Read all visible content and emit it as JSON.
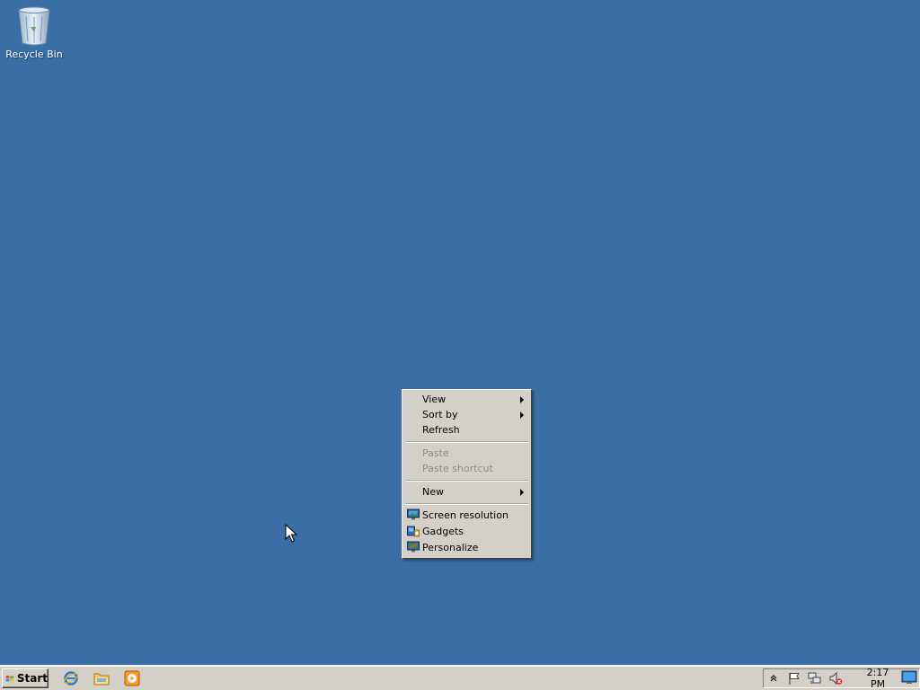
{
  "desktop": {
    "icons": [
      {
        "label": "Recycle Bin",
        "icon": "recycle-bin-icon"
      }
    ]
  },
  "context_menu": {
    "items": [
      {
        "label": "View",
        "submenu": true,
        "enabled": true
      },
      {
        "label": "Sort by",
        "submenu": true,
        "enabled": true
      },
      {
        "label": "Refresh",
        "submenu": false,
        "enabled": true
      },
      {
        "label": "Paste",
        "submenu": false,
        "enabled": false
      },
      {
        "label": "Paste shortcut",
        "submenu": false,
        "enabled": false
      },
      {
        "label": "New",
        "submenu": true,
        "enabled": true
      },
      {
        "label": "Screen resolution",
        "icon": "screen-resolution-icon",
        "enabled": true
      },
      {
        "label": "Gadgets",
        "icon": "gadgets-icon",
        "enabled": true
      },
      {
        "label": "Personalize",
        "icon": "personalize-icon",
        "enabled": true
      }
    ]
  },
  "taskbar": {
    "start_label": "Start",
    "quick_launch": [
      "internet-explorer-icon",
      "windows-explorer-icon",
      "media-player-icon"
    ],
    "tray_icons": [
      "action-center-flag-icon",
      "network-icon",
      "volume-muted-icon"
    ],
    "clock": "2:17 PM"
  },
  "colors": {
    "desktop_background": "#3a6ea5",
    "menu_background": "#d4d0c8",
    "disabled_text": "#8d8a82"
  }
}
